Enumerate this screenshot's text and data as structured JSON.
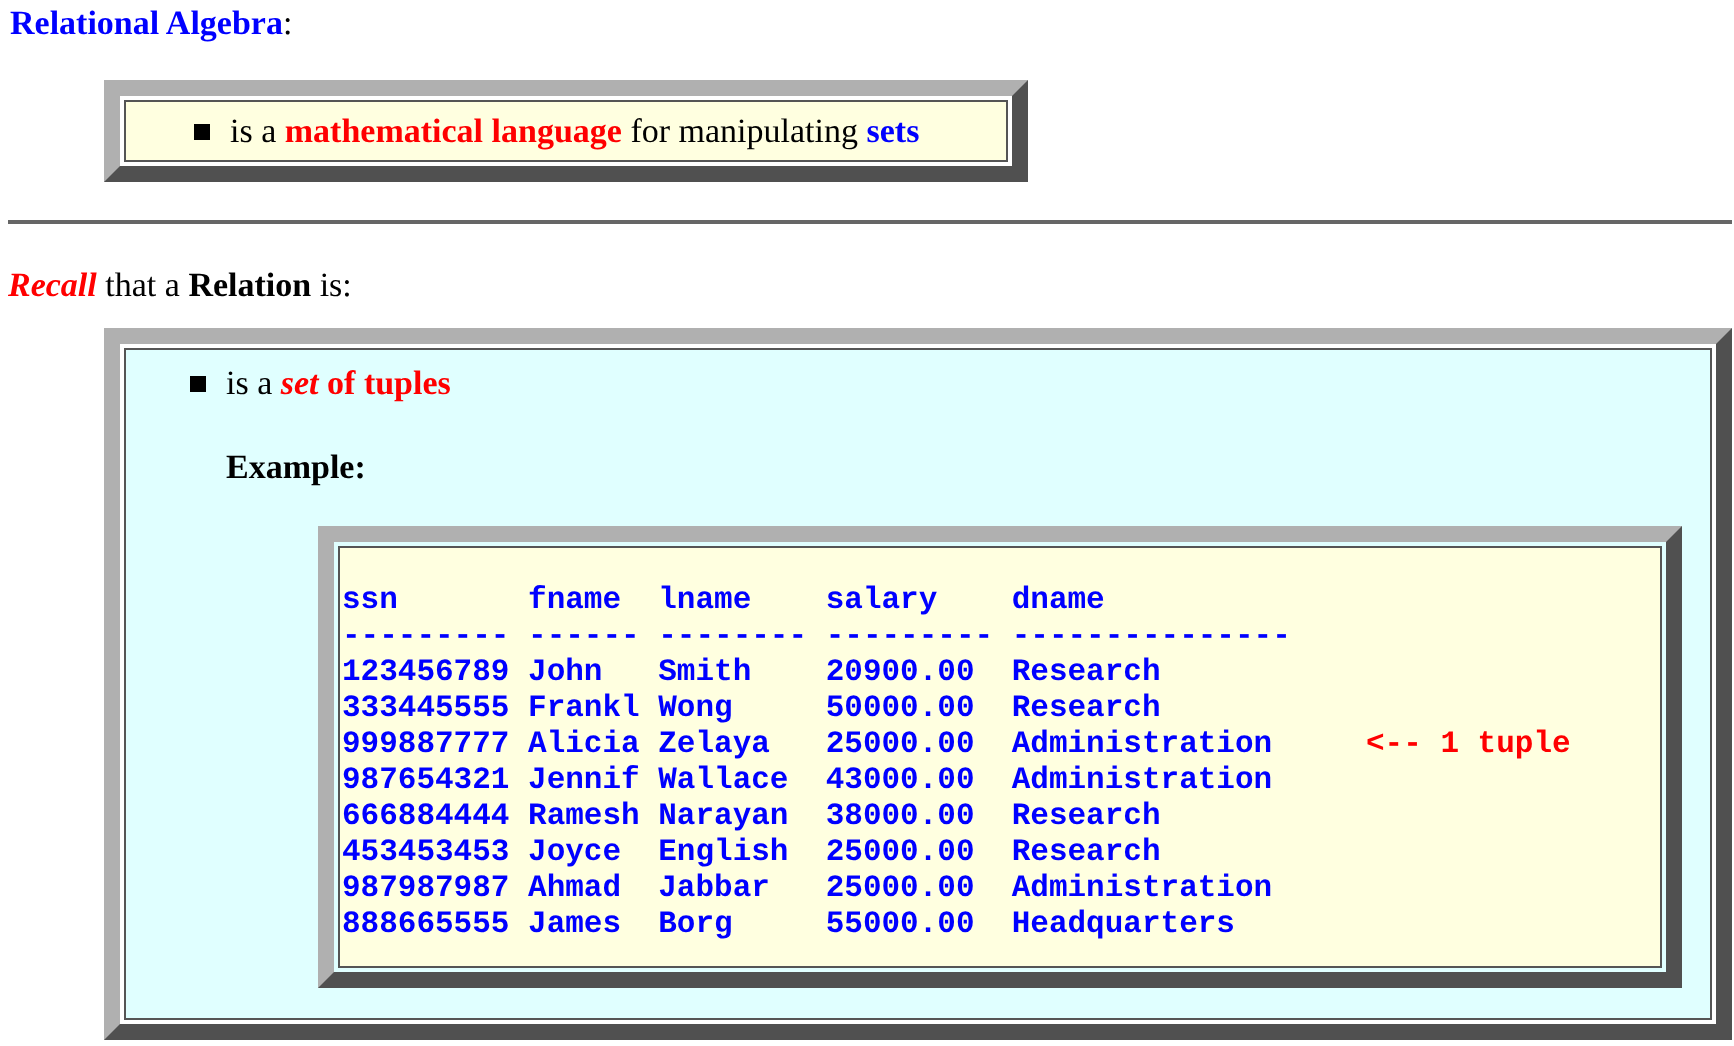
{
  "heading": {
    "title": "Relational Algebra",
    "suffix": ":"
  },
  "definition_box": {
    "bullet": [
      {
        "text": "is a "
      },
      {
        "text": "mathematical language",
        "color": "#ff0000"
      },
      {
        "text": " for manipulating "
      },
      {
        "text": "sets",
        "color": "#0000ff"
      }
    ]
  },
  "recall": [
    {
      "text": "Recall",
      "color": "#ff0000",
      "italic": true,
      "bold": true
    },
    {
      "text": " that a "
    },
    {
      "text": "Relation",
      "bold": true
    },
    {
      "text": " is:"
    }
  ],
  "relation_box": {
    "bullet": [
      {
        "text": "is a "
      },
      {
        "text": "set",
        "color": "#ff0000",
        "italic": true,
        "bold": true
      },
      {
        "text": " of tuples",
        "color": "#ff0000",
        "bold": true
      }
    ],
    "example_label": "Example:",
    "listing": [
      {
        "line": "ssn       fname  lname    salary    dname"
      },
      {
        "line": "--------- ------ -------- --------- ---------------"
      },
      {
        "line": "123456789 John   Smith    20900.00  Research"
      },
      {
        "line": "333445555 Frankl Wong     50000.00  Research"
      },
      {
        "line": "999887777 Alicia Zelaya   25000.00  Administration",
        "note": "<-- 1 tuple"
      },
      {
        "line": "987654321 Jennif Wallace  43000.00  Administration"
      },
      {
        "line": "666884444 Ramesh Narayan  38000.00  Research"
      },
      {
        "line": "453453453 Joyce  English  25000.00  Research"
      },
      {
        "line": "987987987 Ahmad  Jabbar   25000.00  Administration"
      },
      {
        "line": "888665555 James  Borg     55000.00  Headquarters"
      }
    ]
  }
}
